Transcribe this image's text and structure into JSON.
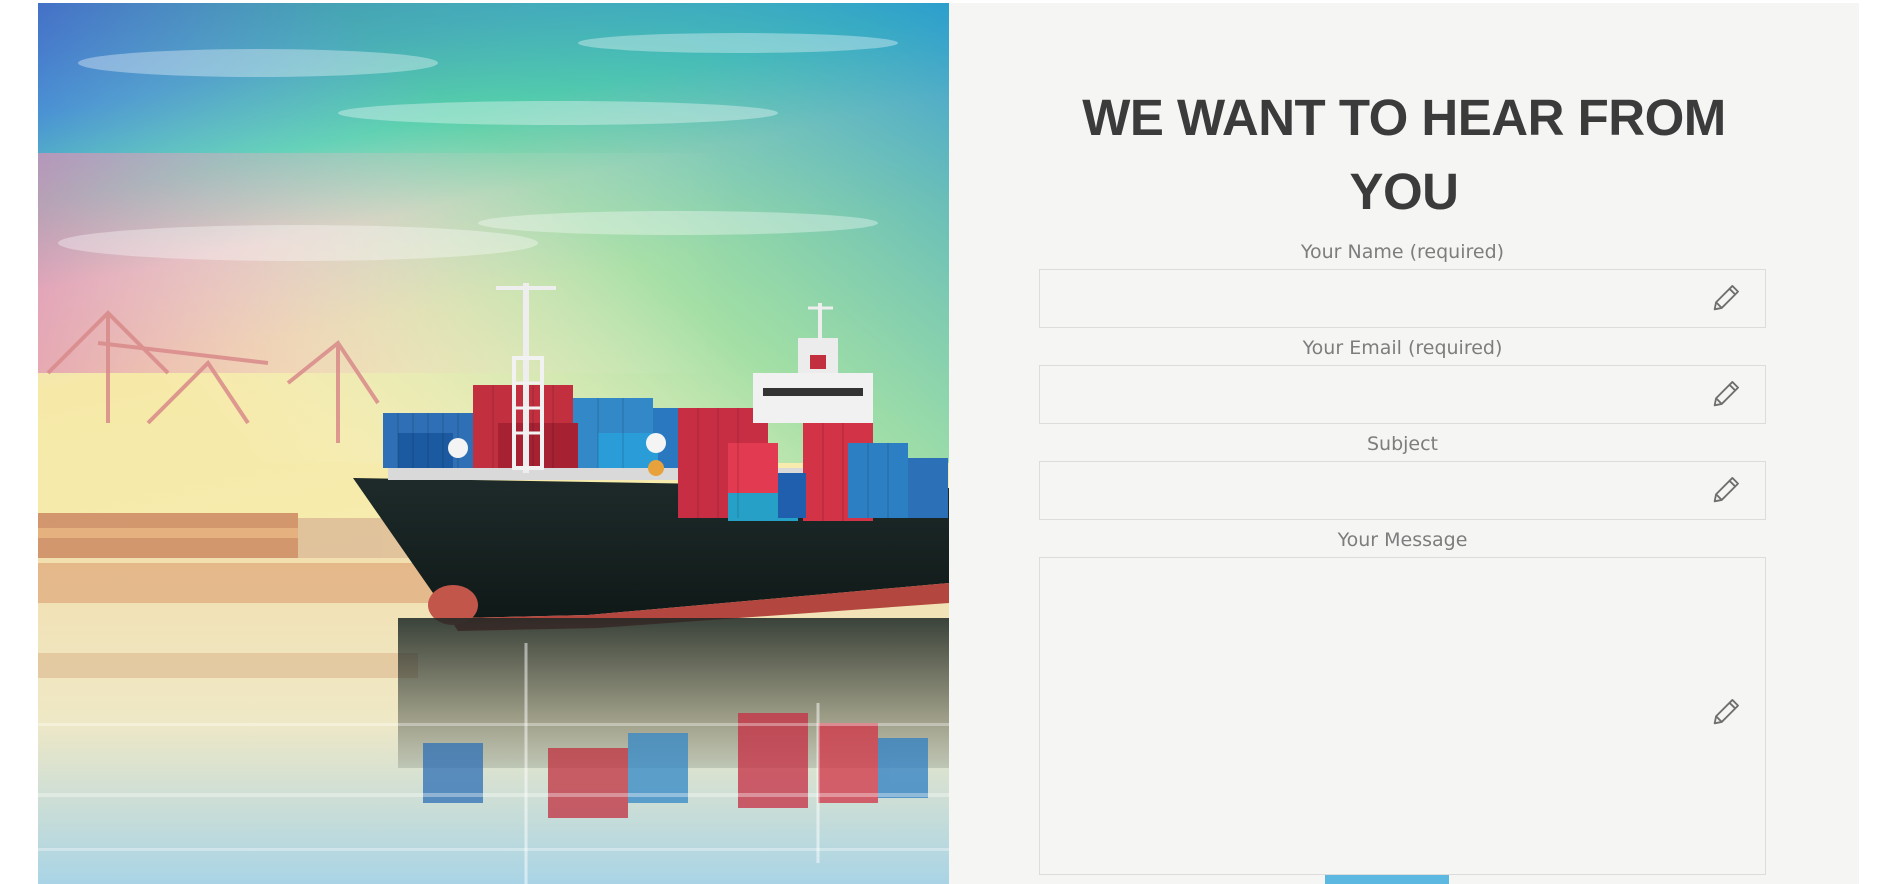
{
  "hero": {
    "alt": "Container ship at port"
  },
  "form": {
    "heading": "WE WANT TO HEAR FROM YOU",
    "fields": [
      {
        "label": "Your Name (required)",
        "value": "",
        "icon": "pencil-icon"
      },
      {
        "label": "Your Email (required)",
        "value": "",
        "icon": "pencil-icon"
      },
      {
        "label": "Subject",
        "value": "",
        "icon": "pencil-icon"
      },
      {
        "label": "Your Message",
        "value": "",
        "icon": "pencil-icon"
      }
    ],
    "submit_label": ""
  },
  "colors": {
    "panel_bg": "#f5f5f4",
    "heading": "#3b3b3b",
    "label": "#7d7d7d",
    "border": "#dcdcdc",
    "submit": "#5cb8e0"
  }
}
